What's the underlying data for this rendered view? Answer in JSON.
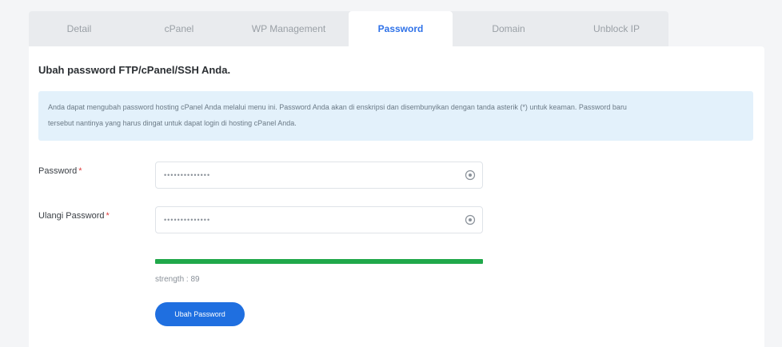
{
  "tabs": [
    {
      "label": "Detail",
      "active": false
    },
    {
      "label": "cPanel",
      "active": false
    },
    {
      "label": "WP Management",
      "active": false
    },
    {
      "label": "Password",
      "active": true
    },
    {
      "label": "Domain",
      "active": false
    },
    {
      "label": "Unblock IP",
      "active": false
    }
  ],
  "heading": "Ubah password FTP/cPanel/SSH Anda.",
  "info": {
    "line1": "Anda dapat mengubah password hosting cPanel Anda melalui menu ini. Password Anda akan di enskripsi dan disembunyikan dengan tanda asterik (*) untuk keaman. Password baru",
    "line2": "tersebut nantinya yang harus dingat untuk dapat login di hosting cPanel Anda."
  },
  "form": {
    "password_label": "Password",
    "password_value": "••••••••••••••",
    "confirm_label": "Ulangi Password",
    "confirm_value": "••••••••••••••",
    "required_mark": "*"
  },
  "strength": {
    "text": "strength : 89",
    "percent": 100
  },
  "submit_label": "Ubah Password",
  "colors": {
    "accent": "#1f6fe0",
    "active_tab_text": "#2f72e8",
    "strength_bar": "#20a84a",
    "info_bg": "#e3f1fb",
    "required": "#e03c3c"
  },
  "icons": {
    "visibility_toggle": "eye-icon"
  }
}
